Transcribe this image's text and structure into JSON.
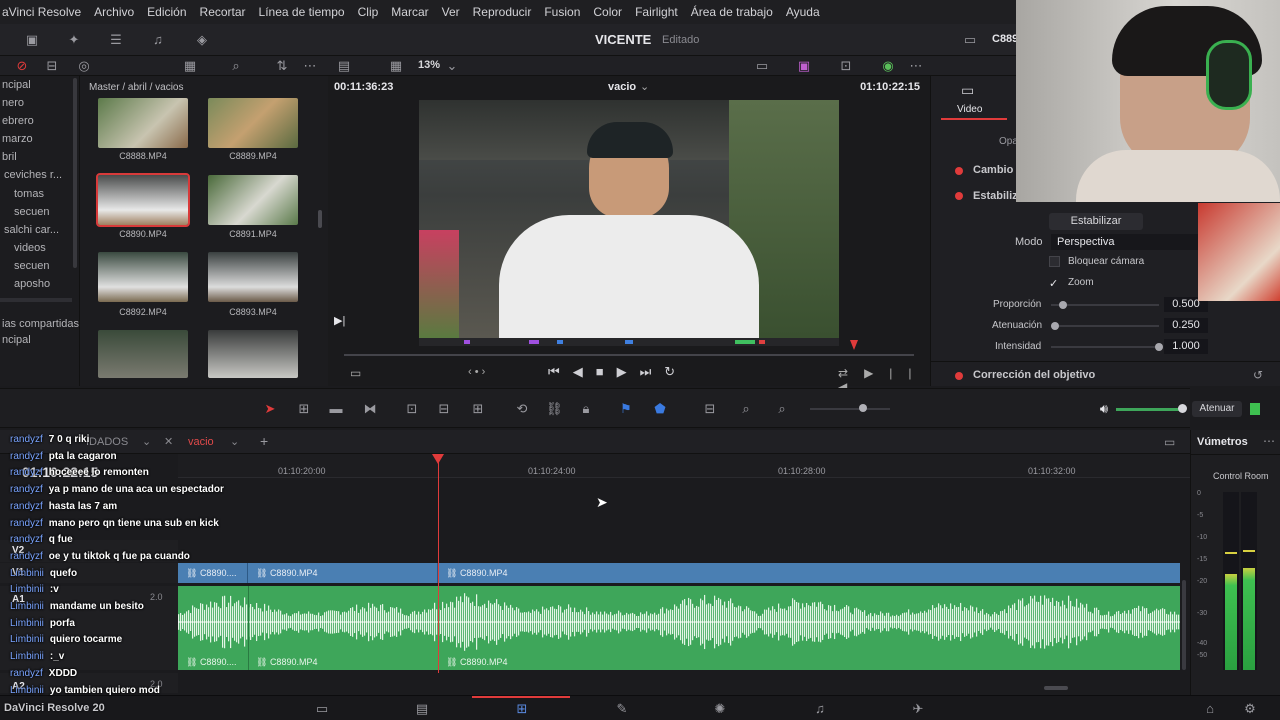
{
  "menu": [
    "aVinci Resolve",
    "Archivo",
    "Edición",
    "Recortar",
    "Línea de tiempo",
    "Clip",
    "Marcar",
    "Ver",
    "Reproducir",
    "Fusion",
    "Color",
    "Fairlight",
    "Área de trabajo",
    "Ayuda"
  ],
  "toolbar": {
    "project_title": "VICENTE",
    "project_status": "Editado",
    "zoom": "13%",
    "clip_name": "C889"
  },
  "bins": [
    "ncipal",
    "nero",
    "ebrero",
    "marzo",
    "bril",
    "ceviches r...",
    "tomas",
    "secuen",
    "salchi car...",
    "videos",
    "secuen",
    "aposho",
    "ias compartidas",
    "ncipal"
  ],
  "media_pool": {
    "path": "Master / abril / vacios",
    "clips": [
      "C8888.MP4",
      "C8889.MP4",
      "C8890.MP4",
      "C8891.MP4",
      "C8892.MP4",
      "C8893.MP4",
      "",
      ""
    ]
  },
  "viewer": {
    "timecode_left": "00:11:36:23",
    "name": "vacio",
    "timecode_right": "01:10:22:15"
  },
  "inspector": {
    "tab": "Video",
    "cut_label": "Opa",
    "sections": [
      "Cambio d",
      "Estabiliza",
      "Corrección del objetivo"
    ],
    "stabilize_button": "Estabilizar",
    "mode_label": "Modo",
    "mode_value": "Perspectiva",
    "lock_camera": "Bloquear cámara",
    "zoom_label": "Zoom",
    "params": [
      {
        "label": "Proporción",
        "value": "0.500",
        "level": 0.08
      },
      {
        "label": "Atenuación",
        "value": "0.250",
        "level": 0.0
      },
      {
        "label": "Intensidad",
        "value": "1.000",
        "level": 1.0
      }
    ]
  },
  "edit_toolbar": {
    "dim_label": "Atenuar"
  },
  "timeline": {
    "tab_name": "vacio",
    "tab_prefix": "IDADOS",
    "timecode": "01:10:22:15",
    "ruler": [
      "01:10:20:00",
      "01:10:24:00",
      "01:10:28:00",
      "01:10:32:00"
    ],
    "tracks": [
      "V2",
      "V1",
      "A1",
      "A2"
    ],
    "a1_gain": "2.0",
    "a2_gain": "2.0",
    "video_clips": [
      "C8890....",
      "C8890.MP4",
      "C8890.MP4"
    ],
    "audio_clips": [
      "C8890....",
      "C8890.MP4",
      "C8890.MP4"
    ]
  },
  "meters": {
    "title": "Vúmetros",
    "room": "Control Room",
    "scale": [
      "0",
      "-5",
      "-10",
      "-15",
      "-20",
      "-30",
      "-40",
      "-50"
    ]
  },
  "chat": [
    {
      "user": "randyzf",
      "msg": "7 0 q riki"
    },
    {
      "user": "randyzf",
      "msg": "pta la cagaron"
    },
    {
      "user": "randyzf",
      "msg": "hoceeee lo remonten"
    },
    {
      "user": "randyzf",
      "msg": "ya p mano de una aca un espectador"
    },
    {
      "user": "randyzf",
      "msg": "hasta las 7 am"
    },
    {
      "user": "randyzf",
      "msg": "mano pero qn tiene una sub en kick"
    },
    {
      "user": "randyzf",
      "msg": "q fue"
    },
    {
      "user": "randyzf",
      "msg": "oe y tu tiktok q fue pa cuando"
    },
    {
      "user": "Limbinii",
      "msg": "quefo"
    },
    {
      "user": "Limbinii",
      "msg": ":v"
    },
    {
      "user": "Limbinii",
      "msg": "mandame un besito"
    },
    {
      "user": "Limbinii",
      "msg": "porfa"
    },
    {
      "user": "Limbinii",
      "msg": "quiero tocarme"
    },
    {
      "user": "Limbinii",
      "msg": ":_v"
    },
    {
      "user": "randyzf",
      "msg": "XDDD"
    },
    {
      "user": "Limbinii",
      "msg": "yo tambien quiero mod"
    }
  ],
  "pagebar": {
    "app_label": "DaVinci Resolve 20"
  },
  "colors": {
    "accent": "#e03b3b",
    "video_clip": "#4a7fb3",
    "audio_clip": "#3ea65a",
    "chat_user": "#7aa4ff"
  },
  "icons": [
    "media-icon",
    "effects-icon",
    "list-icon",
    "audio-icon",
    "search-icon",
    "sort-icon",
    "play-icon",
    "stop-icon",
    "loop-icon",
    "speaker-icon",
    "home-icon",
    "gear-icon"
  ]
}
